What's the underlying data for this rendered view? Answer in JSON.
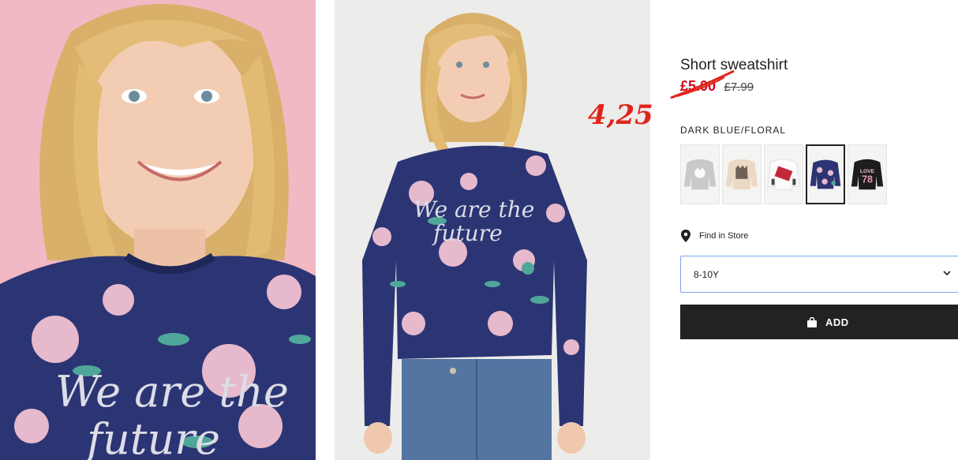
{
  "product": {
    "title": "Short sweatshirt",
    "sale_price": "£5.00",
    "original_price": "£7.99",
    "handwritten_price": "4,25",
    "color_label": "DARK BLUE/FLORAL",
    "find_in_store_label": "Find in Store",
    "size_selected": "8-10Y",
    "add_button_label": "ADD"
  },
  "photos": [
    {
      "print_text": "We are the future"
    },
    {
      "print_text": "We are the future"
    }
  ],
  "swatches": [
    {
      "icon": "grey-unicorn-sweatshirt-icon",
      "selected": false
    },
    {
      "icon": "beige-cat-sweatshirt-icon",
      "selected": false
    },
    {
      "icon": "white-number-sweatshirt-icon",
      "selected": false
    },
    {
      "icon": "navy-floral-sweatshirt-icon",
      "selected": true
    },
    {
      "icon": "black-love-sweatshirt-icon",
      "selected": false,
      "print_text": "LOVE 78"
    }
  ],
  "colors": {
    "sale": "#d0021b",
    "annotation": "#e0241b",
    "button_bg": "#222222",
    "select_border": "#7aa2f0",
    "sweatshirt_navy": "#2c3574"
  }
}
